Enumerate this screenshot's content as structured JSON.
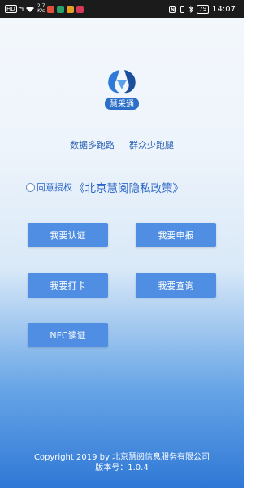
{
  "statusbar": {
    "hd_label": "HD",
    "signal_text": "⁴⁶ᵢₗₗ",
    "speed_value": "2.7",
    "speed_unit": "K/s",
    "battery": "79",
    "time": "14:07"
  },
  "logo": {
    "text": "慧采通"
  },
  "slogans": [
    "数据多跑路",
    "群众少跑腿"
  ],
  "consent": {
    "label": "同意授权",
    "policy_link": "《北京慧阅隐私政策》"
  },
  "buttons": {
    "auth": "我要认证",
    "declare": "我要申报",
    "punch": "我要打卡",
    "query": "我要查询",
    "nfc": "NFC读证"
  },
  "footer": {
    "copyright": "Copyright 2019 by 北京慧阅信息服务有限公司",
    "version": "版本号：1.0.4"
  },
  "colors": {
    "button_bg": "#4f8ee2",
    "link": "#2c67c6",
    "status_bar": "#1b1b1b"
  }
}
